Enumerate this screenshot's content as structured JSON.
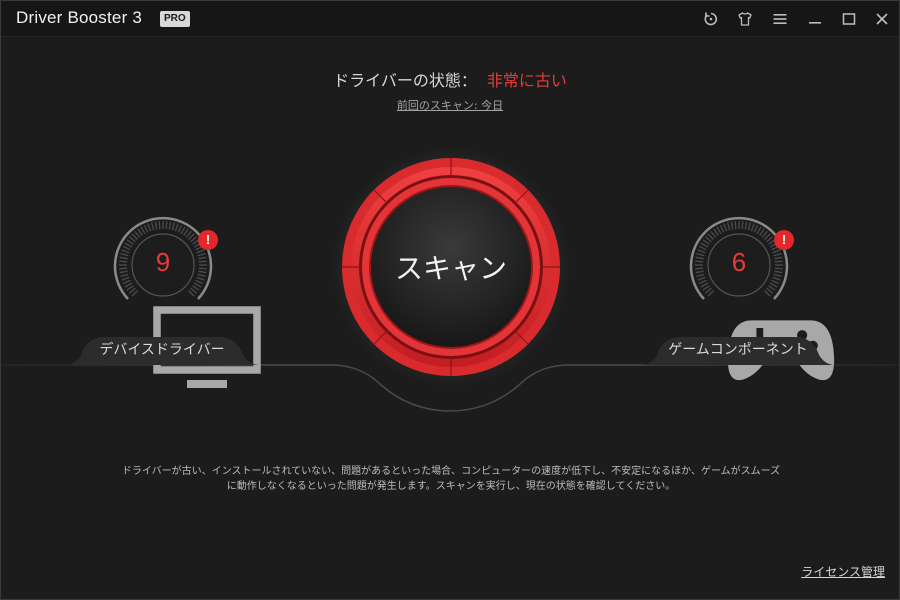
{
  "window": {
    "title": "Driver Booster 3",
    "badge": "PRO",
    "controls": [
      "restore-icon",
      "skin-icon",
      "menu-icon",
      "minimize-icon",
      "maximize-icon",
      "close-icon"
    ]
  },
  "status": {
    "label": "ドライバーの状態：",
    "value": "非常に古い",
    "last_scan": "前回のスキャン: 今日"
  },
  "gauges": {
    "device": {
      "count": "9",
      "alert": "!",
      "label": "デバイスドライバー",
      "icon": "monitor-icon"
    },
    "game": {
      "count": "6",
      "alert": "!",
      "label": "ゲームコンポーネント",
      "icon": "gamepad-icon"
    }
  },
  "scan": {
    "label": "スキャン"
  },
  "description": {
    "line1": "ドライバーが古い、インストールされていない、問題があるといった場合、コンピューターの速度が低下し、不安定になるほか、ゲームがスムーズ",
    "line2": "に動作しなくなるといった問題が発生します。スキャンを実行し、現在の状態を確認してください。"
  },
  "footer": {
    "license": "ライセンス管理"
  },
  "colors": {
    "accent_red": "#e83b3b",
    "background": "#1c1c1c",
    "titlebar": "#161616"
  }
}
